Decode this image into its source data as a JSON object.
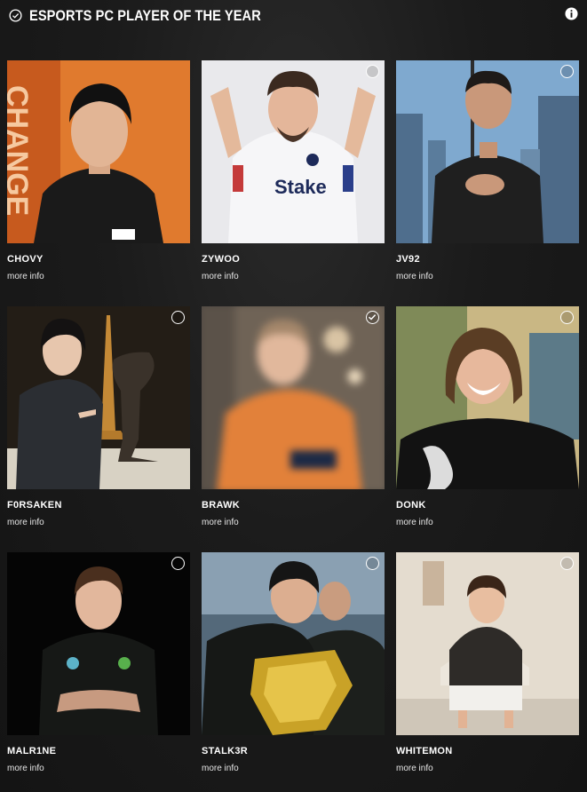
{
  "header": {
    "title": "ESPORTS PC PLAYER OF THE YEAR",
    "leading_icon": "check-circle-icon",
    "trailing_icon": "info-icon"
  },
  "players": [
    {
      "name": "CHOVY",
      "more_info": "more info",
      "selected": false
    },
    {
      "name": "ZYWOO",
      "more_info": "more info",
      "selected": false
    },
    {
      "name": "JV92",
      "more_info": "more info",
      "selected": false
    },
    {
      "name": "F0RSAKEN",
      "more_info": "more info",
      "selected": false
    },
    {
      "name": "BRAWK",
      "more_info": "more info",
      "selected": true
    },
    {
      "name": "DONK",
      "more_info": "more info",
      "selected": false
    },
    {
      "name": "MALR1NE",
      "more_info": "more info",
      "selected": false
    },
    {
      "name": "STALK3R",
      "more_info": "more info",
      "selected": false
    },
    {
      "name": "WHITEMON",
      "more_info": "more info",
      "selected": false
    }
  ],
  "colors": {
    "background": "#1b1b1b",
    "text": "#ffffff",
    "chovy_bg": "#e07a2e",
    "zywoo_bg": "#e9e9ec",
    "jv92_bg": "#7fa9cf",
    "forsaken_bg": "#2a2218",
    "brawk_bg": "#6f6356",
    "donk_bg": "#c9b784",
    "malrine_bg": "#050505",
    "stalk3r_bg": "#54697a",
    "whitemon_bg": "#e4dccf"
  }
}
